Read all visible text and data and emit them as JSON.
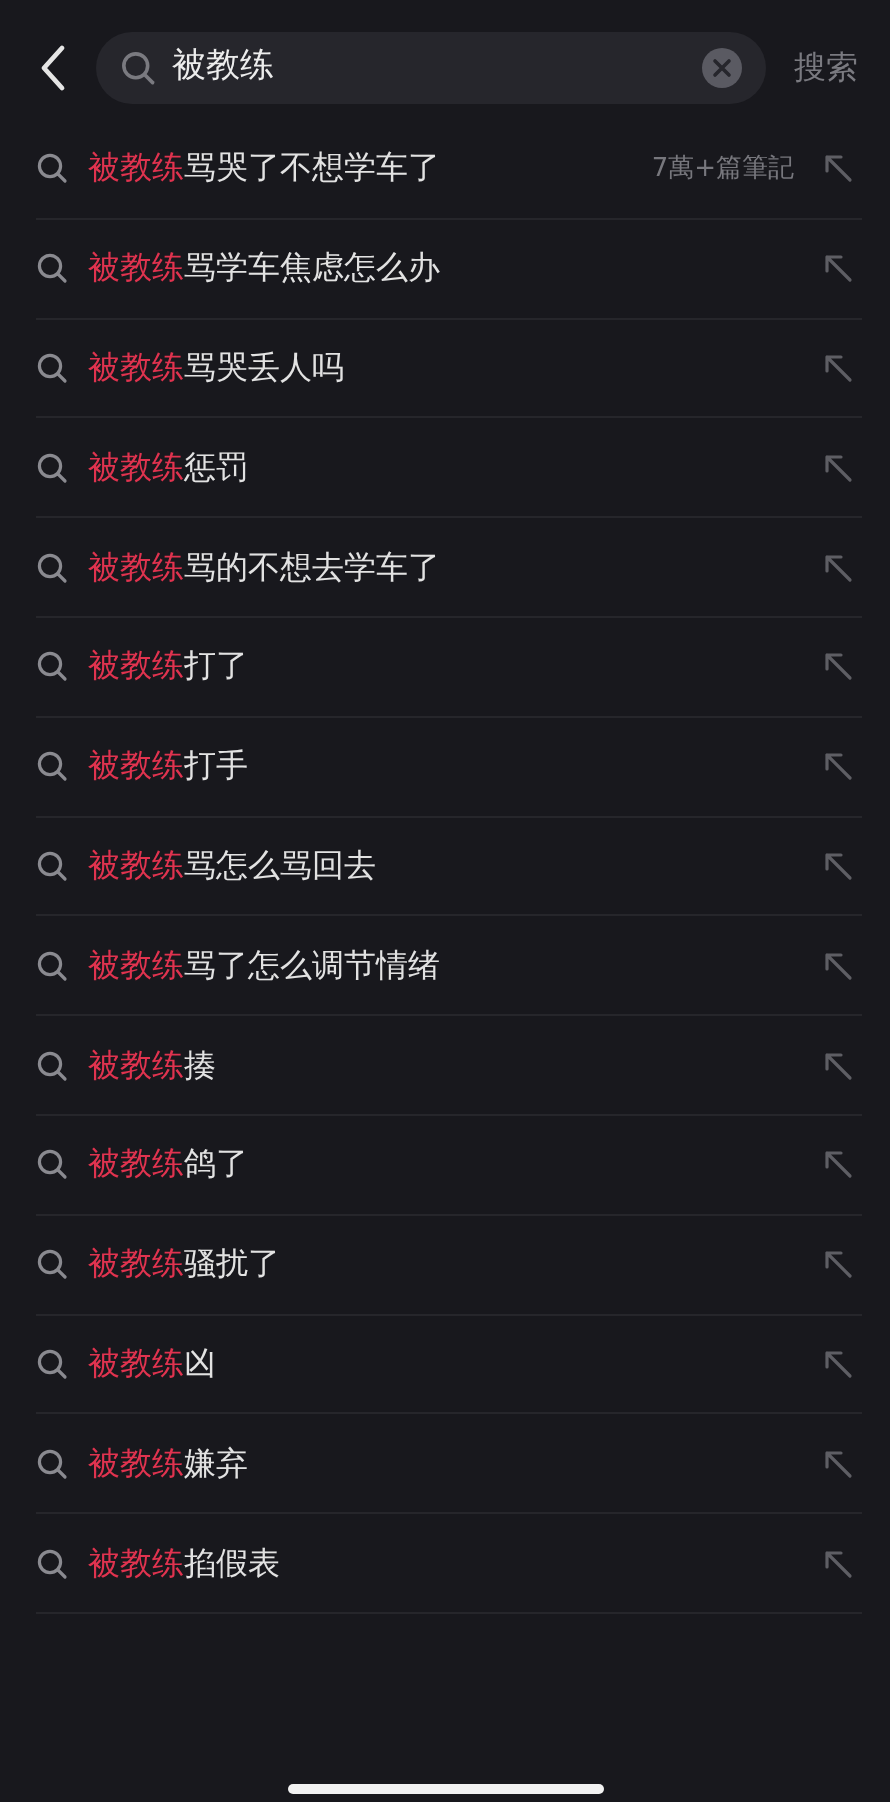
{
  "search": {
    "value": "被教练",
    "action": "搜索"
  },
  "suggestions": [
    {
      "match": "被教练",
      "rest": "骂哭了不想学车了",
      "meta": "7萬+篇筆記"
    },
    {
      "match": "被教练",
      "rest": "骂学车焦虑怎么办"
    },
    {
      "match": "被教练",
      "rest": "骂哭丢人吗"
    },
    {
      "match": "被教练",
      "rest": "惩罚"
    },
    {
      "match": "被教练",
      "rest": "骂的不想去学车了"
    },
    {
      "match": "被教练",
      "rest": "打了"
    },
    {
      "match": "被教练",
      "rest": "打手"
    },
    {
      "match": "被教练",
      "rest": "骂怎么骂回去"
    },
    {
      "match": "被教练",
      "rest": "骂了怎么调节情绪"
    },
    {
      "match": "被教练",
      "rest": "揍"
    },
    {
      "match": "被教练",
      "rest": "鸽了"
    },
    {
      "match": "被教练",
      "rest": "骚扰了"
    },
    {
      "match": "被教练",
      "rest": "凶"
    },
    {
      "match": "被教练",
      "rest": "嫌弃"
    },
    {
      "match": "被教练",
      "rest": "掐假表"
    }
  ]
}
